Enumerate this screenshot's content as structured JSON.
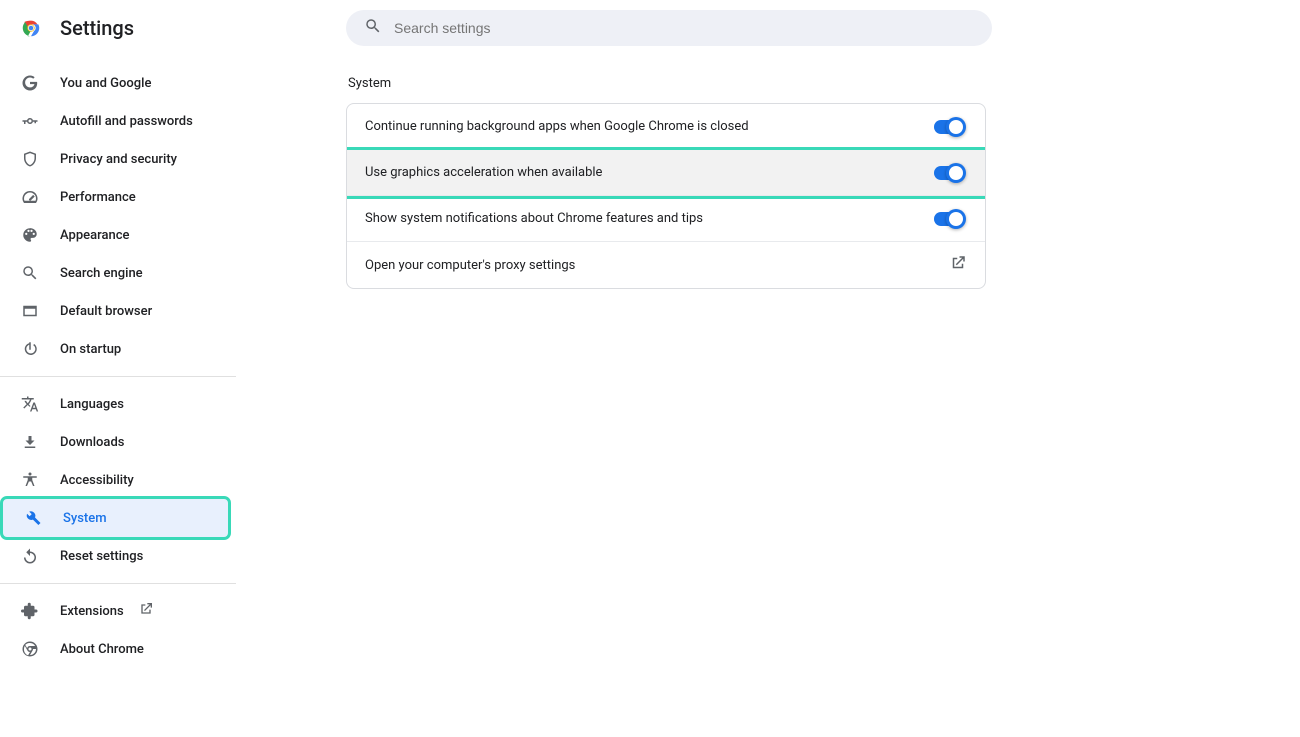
{
  "header": {
    "title": "Settings"
  },
  "search": {
    "placeholder": "Search settings"
  },
  "sidebar": {
    "groups": [
      [
        {
          "label": "You and Google",
          "icon": "google"
        },
        {
          "label": "Autofill and passwords",
          "icon": "key"
        },
        {
          "label": "Privacy and security",
          "icon": "shield"
        },
        {
          "label": "Performance",
          "icon": "speed"
        },
        {
          "label": "Appearance",
          "icon": "palette"
        },
        {
          "label": "Search engine",
          "icon": "search"
        },
        {
          "label": "Default browser",
          "icon": "browser"
        },
        {
          "label": "On startup",
          "icon": "power"
        }
      ],
      [
        {
          "label": "Languages",
          "icon": "language"
        },
        {
          "label": "Downloads",
          "icon": "download"
        },
        {
          "label": "Accessibility",
          "icon": "accessibility"
        },
        {
          "label": "System",
          "icon": "wrench",
          "active": true,
          "highlighted": true
        },
        {
          "label": "Reset settings",
          "icon": "reset"
        }
      ],
      [
        {
          "label": "Extensions",
          "icon": "extension",
          "external": true
        },
        {
          "label": "About Chrome",
          "icon": "chrome-outline"
        }
      ]
    ]
  },
  "main": {
    "section_title": "System",
    "rows": [
      {
        "label": "Continue running background apps when Google Chrome is closed",
        "type": "toggle",
        "on": true
      },
      {
        "label": "Use graphics acceleration when available",
        "type": "toggle",
        "on": true,
        "highlighted": true
      },
      {
        "label": "Show system notifications about Chrome features and tips",
        "type": "toggle",
        "on": true
      },
      {
        "label": "Open your computer's proxy settings",
        "type": "link"
      }
    ]
  }
}
